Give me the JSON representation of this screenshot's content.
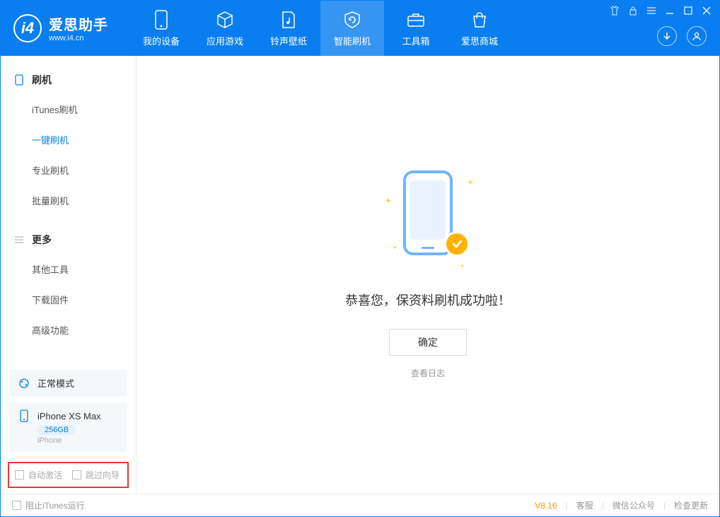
{
  "app": {
    "name": "爱思助手",
    "url": "www.i4.cn"
  },
  "tabs": [
    {
      "label": "我的设备",
      "icon": "device"
    },
    {
      "label": "应用游戏",
      "icon": "cube"
    },
    {
      "label": "铃声壁纸",
      "icon": "music"
    },
    {
      "label": "智能刷机",
      "icon": "refresh",
      "active": true
    },
    {
      "label": "工具箱",
      "icon": "toolbox"
    },
    {
      "label": "爱思商城",
      "icon": "bag"
    }
  ],
  "sidebar": {
    "section1": {
      "title": "刷机",
      "items": [
        "iTunes刷机",
        "一键刷机",
        "专业刷机",
        "批量刷机"
      ],
      "activeIndex": 1
    },
    "section2": {
      "title": "更多",
      "items": [
        "其他工具",
        "下载固件",
        "高级功能"
      ]
    }
  },
  "modeCard": {
    "label": "正常模式"
  },
  "deviceCard": {
    "name": "iPhone XS Max",
    "storage": "256GB",
    "type": "iPhone"
  },
  "checks": {
    "autoActivate": "自动激活",
    "skipGuide": "跳过向导"
  },
  "main": {
    "statusText": "恭喜您，保资料刷机成功啦！",
    "okButton": "确定",
    "viewLog": "查看日志"
  },
  "footer": {
    "blockItunes": "阻止iTunes运行",
    "version": "V8.16",
    "links": [
      "客服",
      "微信公众号",
      "检查更新"
    ]
  }
}
